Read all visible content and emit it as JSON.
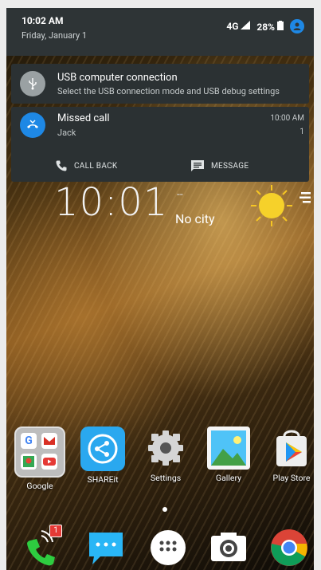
{
  "status_bar": {
    "time": "10:02 AM",
    "date": "Friday, January 1",
    "network": "4G",
    "battery": "28%"
  },
  "notifications": {
    "usb": {
      "title": "USB computer connection",
      "text": "Select the USB connection mode and USB debug settings"
    },
    "missed_call": {
      "title": "Missed call",
      "caller": "Jack",
      "time": "10:00 AM",
      "count": "1",
      "actions": {
        "call_back": "CALL BACK",
        "message": "MESSAGE"
      }
    }
  },
  "widget": {
    "clock": "10:01",
    "temperature": "--",
    "location": "No city"
  },
  "apps": [
    {
      "label": "Google"
    },
    {
      "label": "SHAREit"
    },
    {
      "label": "Settings"
    },
    {
      "label": "Gallery"
    },
    {
      "label": "Play Store"
    }
  ],
  "dock": {
    "phone_badge": "1"
  },
  "colors": {
    "accent": "#1e88e5",
    "notification_bg": "#2b3133"
  },
  "icons": [
    "usb-icon",
    "missed-call-icon",
    "phone-icon",
    "message-icon",
    "avatar-icon",
    "sun-icon",
    "chrome-icon",
    "camera-icon",
    "apps-drawer-icon"
  ]
}
